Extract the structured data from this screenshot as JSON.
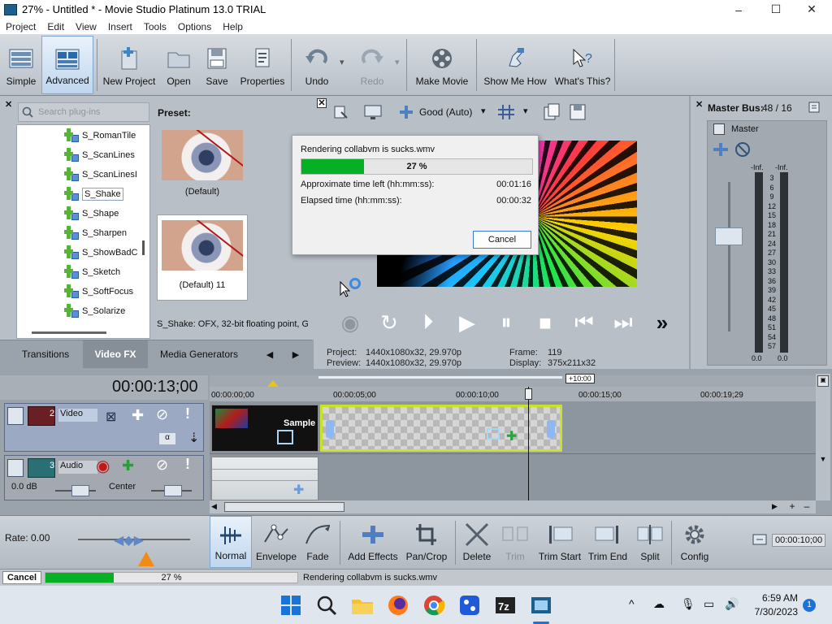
{
  "window": {
    "title": "27% - Untitled * - Movie Studio Platinum 13.0 TRIAL",
    "min": "–",
    "max": "☐",
    "close": "✕"
  },
  "menu": [
    "Project",
    "Edit",
    "View",
    "Insert",
    "Tools",
    "Options",
    "Help"
  ],
  "toolbar": {
    "simple": "Simple",
    "advanced": "Advanced",
    "new_project": "New Project",
    "open": "Open",
    "save": "Save",
    "properties": "Properties",
    "undo": "Undo",
    "redo": "Redo",
    "make_movie": "Make Movie",
    "show_me_how": "Show Me How",
    "whats_this": "What's This?"
  },
  "plugins": {
    "search_placeholder": "Search plug-ins",
    "items": [
      "S_RomanTile",
      "S_ScanLines",
      "S_ScanLinesI",
      "S_Shake",
      "S_Shape",
      "S_Sharpen",
      "S_ShowBadC",
      "S_Sketch",
      "S_SoftFocus",
      "S_Solarize"
    ],
    "selected": "S_Shake"
  },
  "preset": {
    "label": "Preset:",
    "items": [
      "(Default)",
      "(Default) 11"
    ],
    "description": "S_Shake: OFX, 32-bit floating point, G"
  },
  "tabs": {
    "transitions": "Transitions",
    "video_fx": "Video FX",
    "media_generators": "Media Generators",
    "prev": "◀",
    "next": "▶"
  },
  "preview": {
    "quality": "Good (Auto)",
    "project_label": "Project:",
    "project_value": "1440x1080x32, 29.970p",
    "preview_label": "Preview:",
    "preview_value": "1440x1080x32, 29.970p",
    "frame_label": "Frame:",
    "frame_value": "119",
    "display_label": "Display:",
    "display_value": "375x211x32"
  },
  "dialog": {
    "title": "Rendering collabvm is sucks.wmv",
    "progress": 27,
    "progress_text": "27 %",
    "time_left_label": "Approximate time left (hh:mm:ss):",
    "time_left": "00:01:16",
    "elapsed_label": "Elapsed time (hh:mm:ss):",
    "elapsed": "00:00:32",
    "cancel": "Cancel"
  },
  "master": {
    "title": "Master Bus:",
    "count": "48 / 16",
    "label": "Master",
    "inf_left": "-Inf.",
    "inf_right": "-Inf.",
    "scale": [
      "3",
      "6",
      "9",
      "12",
      "15",
      "18",
      "21",
      "24",
      "27",
      "30",
      "33",
      "36",
      "39",
      "42",
      "45",
      "48",
      "51",
      "54",
      "57"
    ],
    "bottom_left": "0.0",
    "bottom_right": "0.0"
  },
  "timeline": {
    "timecode": "00:00:13;00",
    "zoom_marker": "+10:00",
    "ruler": [
      "00:00:00;00",
      "00:00:05;00",
      "00:00:10;00",
      "00:00:15;00",
      "00:00:19;29"
    ],
    "video_track": {
      "number": "2",
      "name": "Video"
    },
    "audio_track": {
      "number": "3",
      "name": "Audio",
      "volume": "0.0 dB",
      "pan": "Center"
    },
    "clip_text": "Sample"
  },
  "edit_toolbar": {
    "rate": "Rate: 0.00",
    "normal": "Normal",
    "envelope": "Envelope",
    "fade": "Fade",
    "add_effects": "Add Effects",
    "pan_crop": "Pan/Crop",
    "delete": "Delete",
    "trim": "Trim",
    "trim_start": "Trim Start",
    "trim_end": "Trim End",
    "split": "Split",
    "config": "Config",
    "end_time": "00:00:10;00"
  },
  "status": {
    "cancel": "Cancel",
    "progress": 27,
    "progress_text": "27 %",
    "message": "Rendering collabvm is sucks.wmv"
  },
  "taskbar": {
    "time": "6:59 AM",
    "date": "7/30/2023",
    "notifications": "1"
  },
  "colors": {
    "progress": "#06b025",
    "accent": "#3a78d4",
    "clip_border": "#c9e326"
  }
}
